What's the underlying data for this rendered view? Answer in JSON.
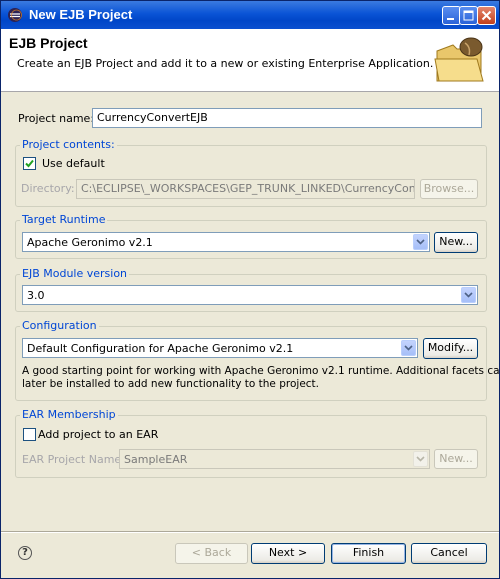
{
  "window": {
    "title": "New EJB Project"
  },
  "banner": {
    "heading": "EJB Project",
    "description": "Create an EJB Project and add it to a new or existing Enterprise Application."
  },
  "project_name": {
    "label": "Project name:",
    "value": "CurrencyConvertEJB"
  },
  "project_contents": {
    "title": "Project contents:",
    "use_default_label": "Use default",
    "use_default_checked": true,
    "directory_label": "Directory:",
    "directory_value": "C:\\ECLIPSE\\_WORKSPACES\\GEP_TRUNK_LINKED\\CurrencyConvertEJB",
    "browse_label": "Browse..."
  },
  "target_runtime": {
    "title": "Target Runtime",
    "value": "Apache Geronimo v2.1",
    "new_label": "New..."
  },
  "ejb_module_version": {
    "title": "EJB Module version",
    "value": "3.0"
  },
  "configuration": {
    "title": "Configuration",
    "value": "Default Configuration for Apache Geronimo v2.1",
    "modify_label": "Modify...",
    "description_line1": "A good starting point for working with Apache Geronimo v2.1 runtime. Additional facets can",
    "description_line2": "later be installed to add new functionality to the project."
  },
  "ear_membership": {
    "title": "EAR Membership",
    "add_label": "Add project to an EAR",
    "add_checked": false,
    "ear_name_label": "EAR Project Name:",
    "ear_name_value": "SampleEAR",
    "new_label": "New..."
  },
  "footer": {
    "back_label": "< Back",
    "next_label": "Next >",
    "finish_label": "Finish",
    "cancel_label": "Cancel",
    "help_glyph": "?"
  },
  "colors": {
    "title_bar": "#0a54d6",
    "group_title": "#0046d5",
    "dialog_bg": "#ece9d8"
  }
}
